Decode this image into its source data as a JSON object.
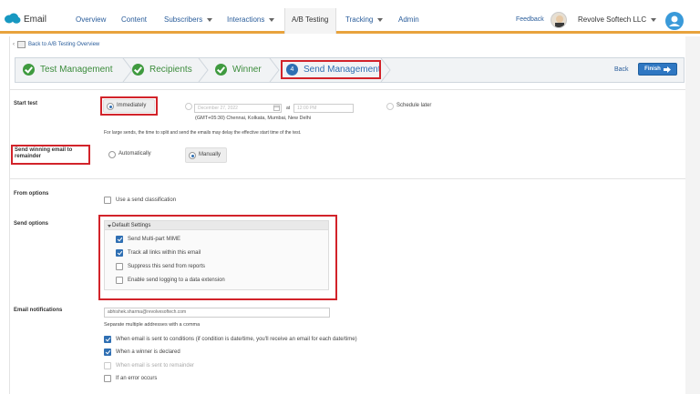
{
  "topnav": {
    "brand": "Email",
    "items": [
      "Overview",
      "Content",
      "Subscribers",
      "Interactions",
      "A/B Testing",
      "Tracking",
      "Admin"
    ],
    "feedback": "Feedback",
    "account": "Revolve Softech LLC"
  },
  "breadcrumb": {
    "back_label": "Back to A/B Testing Overview"
  },
  "wizard": {
    "steps": [
      {
        "label": "Test Management",
        "state": "done"
      },
      {
        "label": "Recipients",
        "state": "done"
      },
      {
        "label": "Winner",
        "state": "done"
      },
      {
        "label": "Send Management",
        "state": "current",
        "number": "4"
      }
    ],
    "back_label": "Back",
    "finish_label": "Finish"
  },
  "start_test": {
    "label": "Start test",
    "immediately": "Immediately",
    "date_value": "December 27, 2022",
    "at_label": "at",
    "time_value": "12:00 PM",
    "timezone": "(GMT+05:30) Chennai, Kolkata, Mumbai, New Delhi",
    "schedule_later": "Schedule later",
    "note": "For large sends, the time to split and send the emails may delay the effective start time of the test."
  },
  "send_winning": {
    "label": "Send winning email to remainder",
    "automatically": "Automatically",
    "manually": "Manually"
  },
  "from_options": {
    "label": "From options",
    "send_classification": "Use a send classification"
  },
  "send_options": {
    "label": "Send options",
    "header": "Default Settings",
    "items": [
      {
        "label": "Send Multi-part MIME",
        "checked": true
      },
      {
        "label": "Track all links within this email",
        "checked": true
      },
      {
        "label": "Suppress this send from reports",
        "checked": false
      },
      {
        "label": "Enable send logging to a data extension",
        "checked": false
      }
    ]
  },
  "email_notifications": {
    "label": "Email notifications",
    "email_value": "abhishek.sharma@revolvesoftech.com",
    "helper": "Separate multiple addresses with a comma",
    "items": [
      {
        "label": "When email is sent to conditions (if condition is date/time, you'll receive an email for each date/time)",
        "checked": true,
        "disabled": false
      },
      {
        "label": "When a winner is declared",
        "checked": true,
        "disabled": false
      },
      {
        "label": "When email is sent to remainder",
        "checked": false,
        "disabled": true
      },
      {
        "label": "If an error occurs",
        "checked": false,
        "disabled": false
      }
    ]
  },
  "colors": {
    "accent_bar": "#e8a33d",
    "highlight": "#d2232a",
    "link": "#2a5d9b",
    "success": "#3f9a3f"
  }
}
